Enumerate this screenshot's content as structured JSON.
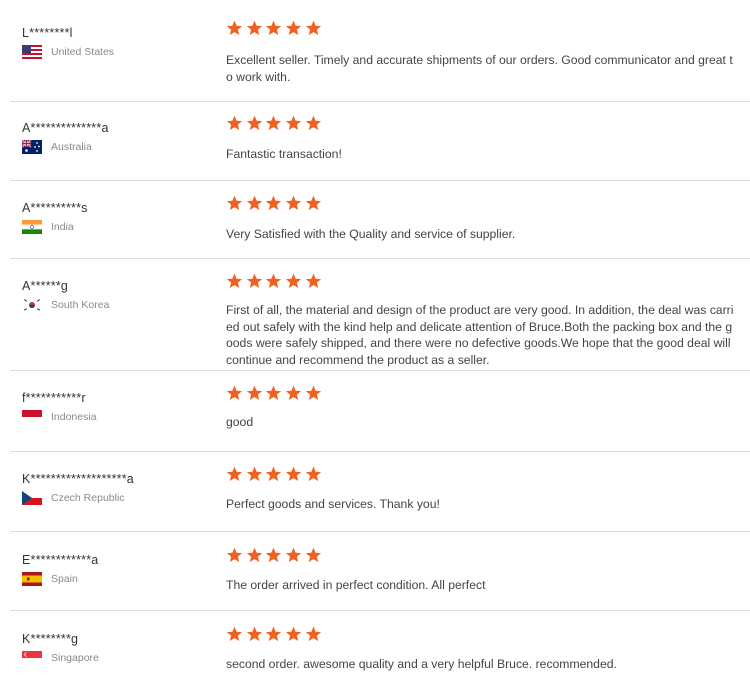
{
  "colors": {
    "star": "#f06222",
    "divider": "#dcdcdc"
  },
  "reviews": [
    {
      "user": "L********l",
      "country": "United States",
      "flag_icon": "us-flag-icon",
      "rating": 5,
      "text": "Excellent seller. Timely and accurate shipments of our orders. Good communicator and great to work with."
    },
    {
      "user": "A**************a",
      "country": "Australia",
      "flag_icon": "au-flag-icon",
      "rating": 5,
      "text": "Fantastic transaction!"
    },
    {
      "user": "A**********s",
      "country": "India",
      "flag_icon": "in-flag-icon",
      "rating": 5,
      "text": "Very Satisfied with the Quality and service of supplier."
    },
    {
      "user": "A******g",
      "country": "South Korea",
      "flag_icon": "kr-flag-icon",
      "rating": 5,
      "text": "First of all, the material and design of the product are very good. In addition, the deal was carried out safely with the kind help and delicate attention of Bruce.Both the packing box and the goods were safely shipped, and there were no defective goods.We hope that the good deal will continue and recommend the product as a seller."
    },
    {
      "user": "f***********r",
      "country": "Indonesia",
      "flag_icon": "id-flag-icon",
      "rating": 5,
      "text": "good"
    },
    {
      "user": "K*******************a",
      "country": "Czech Republic",
      "flag_icon": "cz-flag-icon",
      "rating": 5,
      "text": "Perfect goods and services. Thank you!"
    },
    {
      "user": "E************a",
      "country": "Spain",
      "flag_icon": "es-flag-icon",
      "rating": 5,
      "text": "The order arrived in perfect condition. All perfect"
    },
    {
      "user": "K********g",
      "country": "Singapore",
      "flag_icon": "sg-flag-icon",
      "rating": 5,
      "text": "second order. awesome quality and a very helpful Bruce. recommended."
    }
  ]
}
